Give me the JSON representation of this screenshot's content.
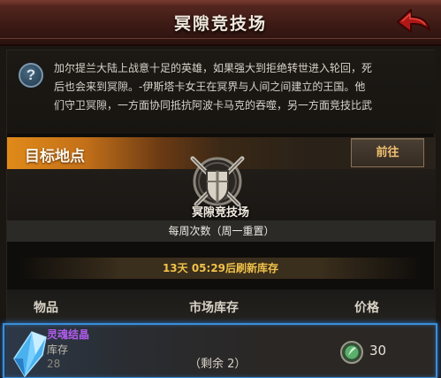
{
  "header": {
    "title": "冥隙竞技场",
    "back_icon": "red-back-arrow-icon"
  },
  "description": {
    "help_symbol": "?",
    "lines": [
      "加尔提兰大陆上战意十足的英雄，如果强大到拒绝转世进入轮回，死",
      "后也会来到冥隙。-伊斯塔卡女王在冥界与人间之间建立的王国。他",
      "们守卫冥隙，一方面协同抵抗阿波卡马克的吞噬，另一方面竞技比武"
    ]
  },
  "target": {
    "label": "目标地点",
    "goto_label": "前往",
    "arena_name": "冥隙竞技场",
    "weekly_count": "每周次数（周一重置）",
    "refresh_text": "13天 05:29后刷新库存"
  },
  "shop": {
    "columns": {
      "item": "物品",
      "stock": "市场库存",
      "price": "价格"
    },
    "items": [
      {
        "name": "灵魂结晶",
        "stock_label": "库存",
        "stock_value": "28",
        "remaining": "（剩余 2）",
        "price": "30",
        "icon": "soul-crystal-icon",
        "currency_icon": "green-arena-coin-icon"
      }
    ]
  },
  "colors": {
    "accent_orange": "#e08a1a",
    "item_name_purple": "#b25cf0",
    "refresh_gold": "#f0c24a",
    "selection_blue": "#3a8ed8"
  }
}
